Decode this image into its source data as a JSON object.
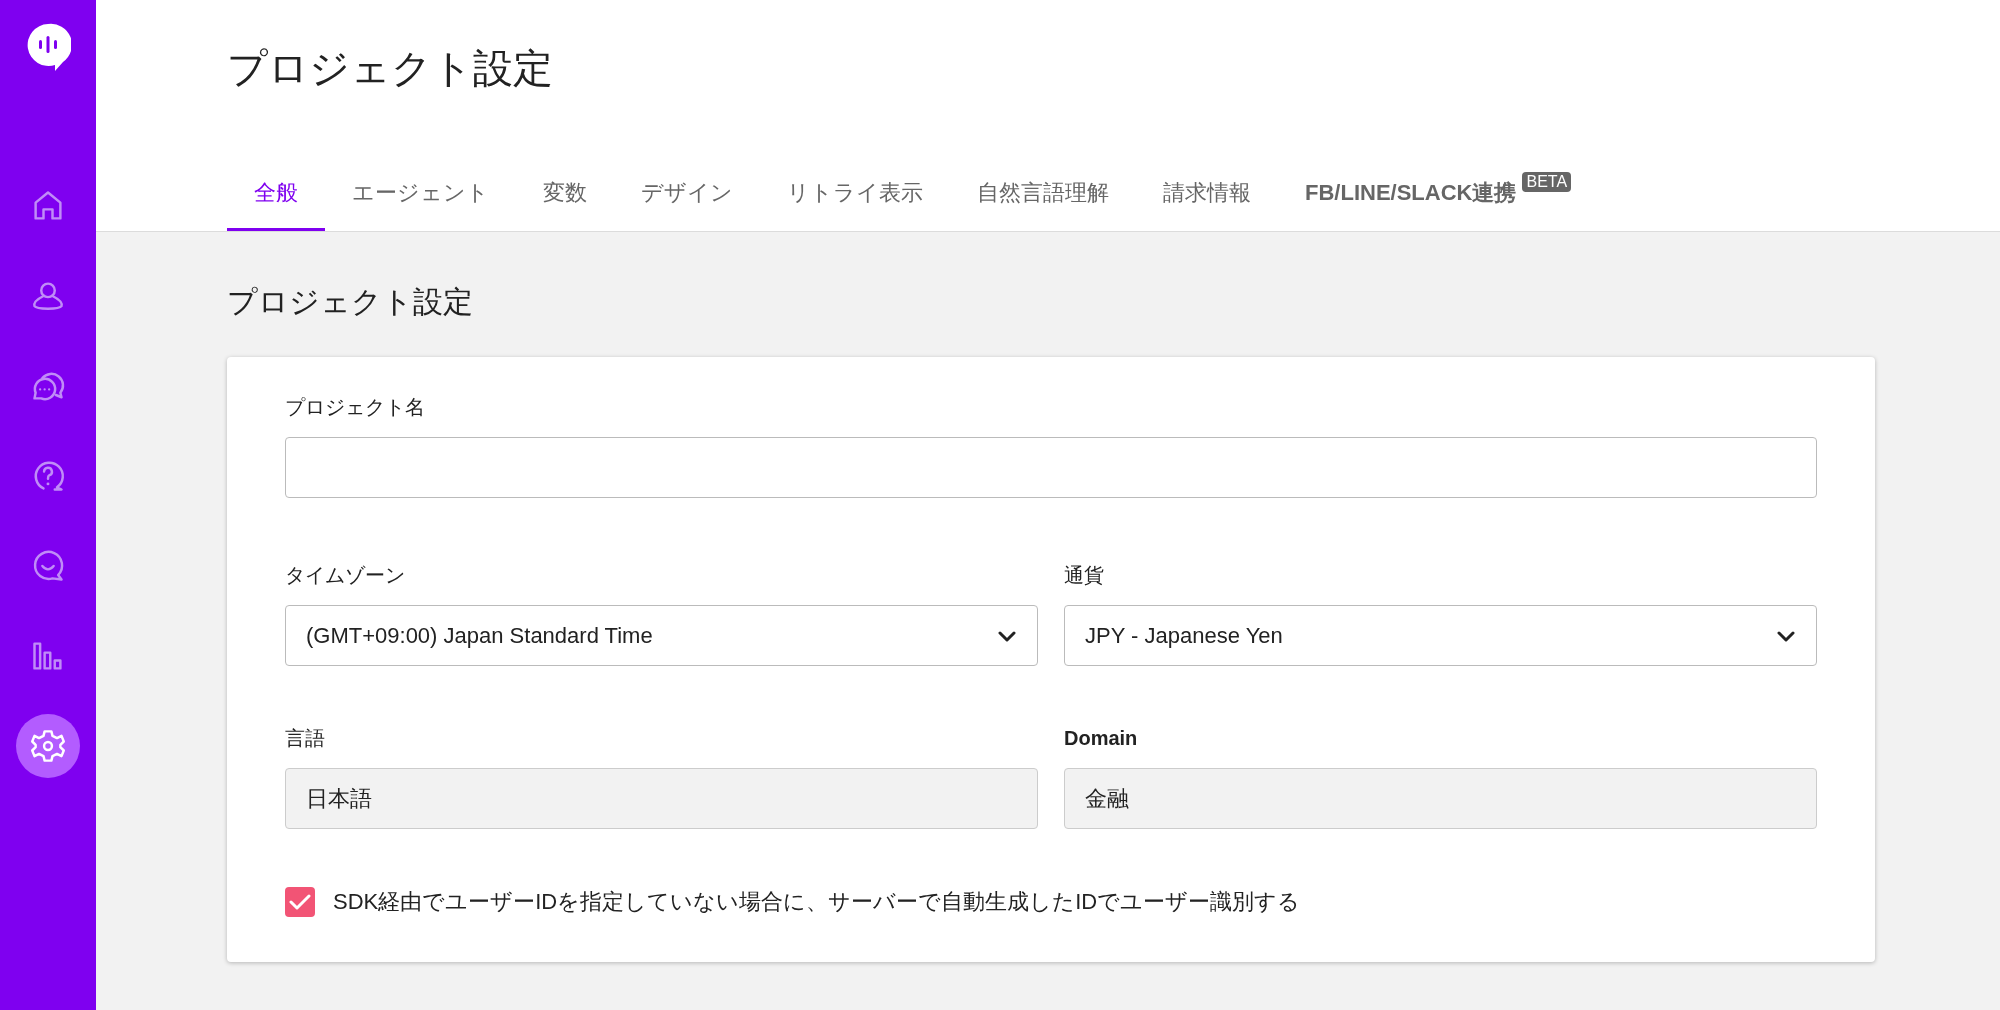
{
  "sidebar": {
    "items": [
      {
        "kind": "home",
        "selected": false
      },
      {
        "kind": "user",
        "selected": false
      },
      {
        "kind": "chat",
        "selected": false
      },
      {
        "kind": "help",
        "selected": false
      },
      {
        "kind": "smile",
        "selected": false
      },
      {
        "kind": "chart",
        "selected": false
      },
      {
        "kind": "settings",
        "selected": true
      }
    ]
  },
  "header": {
    "title": "プロジェクト設定"
  },
  "tabs": [
    {
      "label": "全般",
      "selected": true
    },
    {
      "label": "エージェント",
      "selected": false
    },
    {
      "label": "変数",
      "selected": false
    },
    {
      "label": "デザイン",
      "selected": false
    },
    {
      "label": "リトライ表示",
      "selected": false
    },
    {
      "label": "自然言語理解",
      "selected": false
    },
    {
      "label": "請求情報",
      "selected": false
    },
    {
      "label": "FB/LINE/SLACK連携",
      "selected": false,
      "badge": "BETA"
    }
  ],
  "section": {
    "title": "プロジェクト設定",
    "project_name": {
      "label": "プロジェクト名"
    },
    "fields": [
      {
        "kind": "select",
        "label": "タイムゾーン",
        "value": "(GMT+09:00) Japan Standard Time"
      },
      {
        "kind": "select",
        "label": "通貨",
        "value": "JPY - Japanese Yen"
      },
      {
        "kind": "readonly",
        "label": "言語",
        "value": "日本語"
      },
      {
        "kind": "readonly",
        "label": "Domain",
        "label_bold": true,
        "value": "金融"
      }
    ],
    "checkbox": {
      "label": "SDK経由でユーザーIDを指定していない場合に、サーバーで自動生成したIDでユーザー識別する",
      "checked": true
    }
  }
}
